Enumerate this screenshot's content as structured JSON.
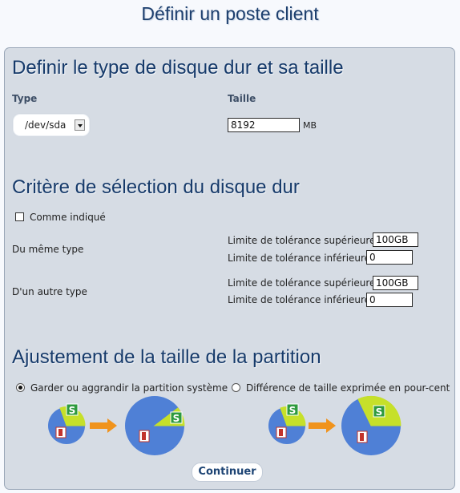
{
  "page": {
    "title": "Définir un poste client"
  },
  "disk": {
    "heading": "Definir le type de disque dur et sa taille",
    "type_label": "Type",
    "type_value": "/dev/sda",
    "size_label": "Taille",
    "size_value": "8192",
    "size_unit": "MB"
  },
  "criteria": {
    "heading": "Critère de sélection du disque dur",
    "as_indicated_label": "Comme indiqué",
    "as_indicated_checked": false,
    "same_type": {
      "label": "Du même type",
      "upper_label": "Limite de tolérance supérieure",
      "upper_value": "100GB",
      "lower_label": "Limite de tolérance inférieure",
      "lower_value": "0"
    },
    "other_type": {
      "label": "D'un autre type",
      "upper_label": "Limite de tolérance supérieure",
      "upper_value": "100GB",
      "lower_label": "Limite de tolérance inférieure",
      "lower_value": "0"
    }
  },
  "partition": {
    "heading": "Ajustement de la taille de la partition",
    "option_keep_label": "Garder ou aggrandir la partition système",
    "option_keep_selected": true,
    "option_percent_label": "Différence de taille exprimée en pour-cent",
    "option_percent_selected": false
  },
  "colors": {
    "pie_blue": "#4f80d6",
    "pie_green": "#c6e02a",
    "arrow_orange": "#f0931c",
    "heading_blue": "#163a6a"
  },
  "icons": [
    "linux-partition-icon",
    "system-partition-icon",
    "arrow-right-icon"
  ],
  "actions": {
    "continue_label": "Continuer"
  }
}
